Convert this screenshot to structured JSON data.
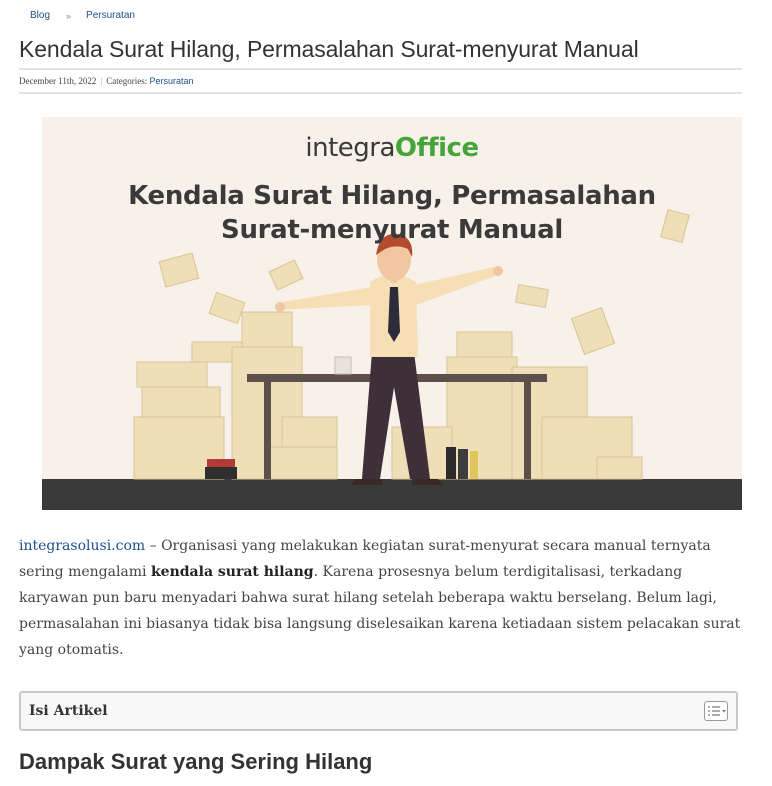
{
  "breadcrumb": {
    "home": "Blog",
    "separator": "»",
    "category": "Persuratan"
  },
  "post": {
    "title": "Kendala Surat Hilang, Permasalahan Surat-menyurat Manual",
    "date": "December 11th, 2022",
    "meta_separator": "|",
    "categories_label": "Categories:",
    "category": "Persuratan"
  },
  "hero": {
    "brand_part1": "integra",
    "brand_part2": "Office",
    "title_line1": "Kendala Surat Hilang, Permasalahan",
    "title_line2": "Surat-menyurat Manual",
    "background_color": "#f7f1ea",
    "brand_accent_color": "#46a53a"
  },
  "intro": {
    "link_text": "integrasolusi.com",
    "text_before_bold": " – Organisasi yang melakukan kegiatan surat-menyurat secara manual ternyata sering mengalami ",
    "bold_text": "kendala surat hilang",
    "text_after_bold": ". Karena prosesnya belum terdigitalisasi, terkadang karyawan pun baru menyadari bahwa surat hilang setelah beberapa waktu berselang. Belum lagi, permasalahan ini biasanya tidak bisa langsung diselesaikan karena ketiadaan sistem pelacakan surat yang otomatis."
  },
  "toc": {
    "title": "Isi Artikel",
    "toggle_icon": "list-toggle-icon"
  },
  "section": {
    "heading": "Dampak Surat yang Sering Hilang"
  },
  "colors": {
    "link": "#1f4e8c",
    "text": "#444444"
  }
}
